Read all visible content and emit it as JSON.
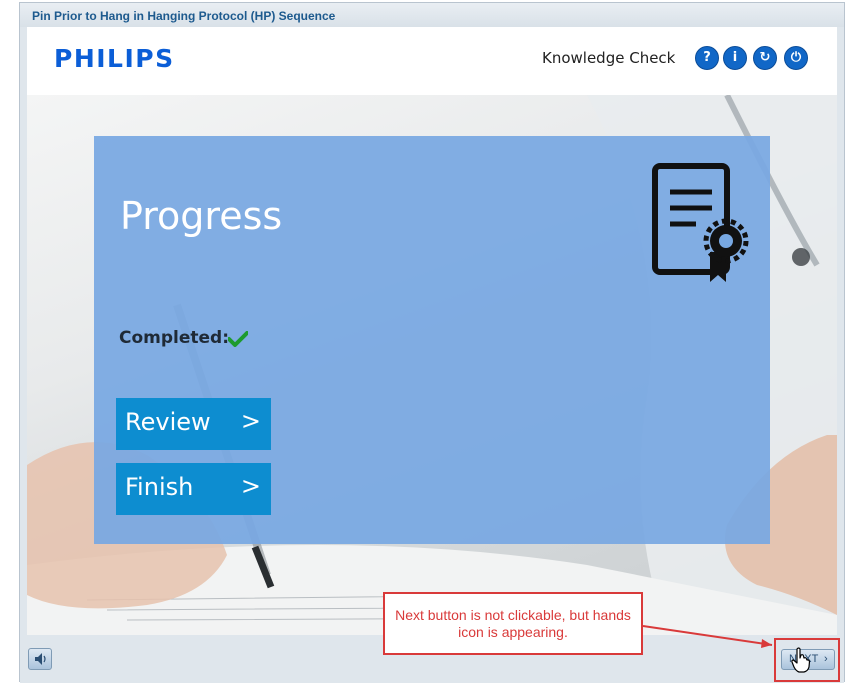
{
  "window": {
    "title": "Pin Prior to Hang in Hanging Protocol (HP) Sequence"
  },
  "header": {
    "logo": "PHILIPS",
    "section_title": "Knowledge Check",
    "buttons": [
      {
        "icon": "help-icon",
        "glyph": "?"
      },
      {
        "icon": "info-icon",
        "glyph": "i"
      },
      {
        "icon": "restart-icon",
        "glyph": "↻"
      },
      {
        "icon": "power-icon",
        "glyph": "⏻"
      }
    ]
  },
  "panel": {
    "title": "Progress",
    "completed_label": "Completed:",
    "completed_icon": "green-check-icon",
    "cert_icon": "certificate-icon",
    "buttons": [
      {
        "label": "Review",
        "chevron": ">"
      },
      {
        "label": "Finish",
        "chevron": ">"
      }
    ]
  },
  "footer": {
    "audio_icon": "speaker-icon",
    "next_label": "NEXT",
    "next_chevron": "›",
    "cursor_icon": "hand-pointer-icon"
  },
  "annotation": {
    "text": "Next button is not clickable, but hands icon is appearing.",
    "color": "#d93a3a"
  },
  "colors": {
    "accent": "#0b5ed7",
    "panel": "#78a8e2",
    "button": "#0d8dd0"
  }
}
